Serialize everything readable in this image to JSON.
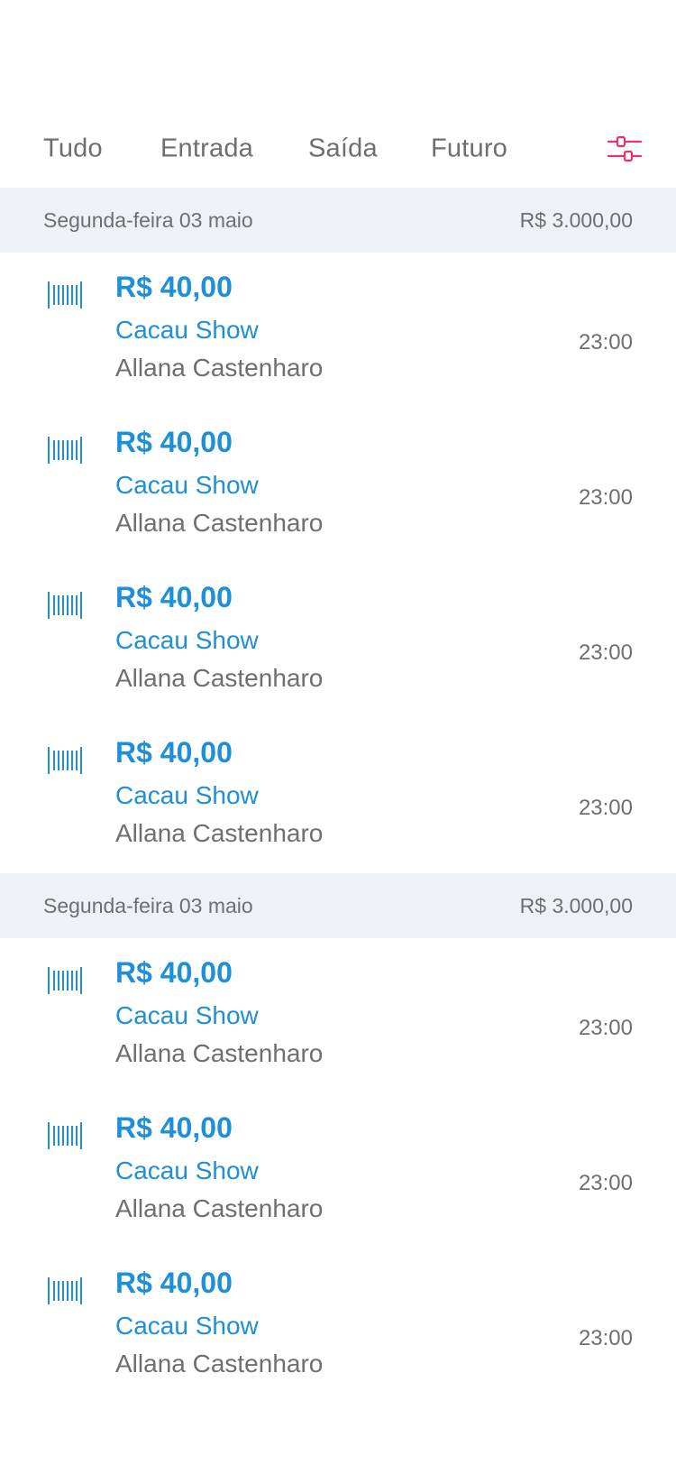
{
  "tabs": {
    "tudo": "Tudo",
    "entrada": "Entrada",
    "saida": "Saída",
    "futuro": "Futuro",
    "filter_icon": "sliders-icon"
  },
  "colors": {
    "accent": "#1e8fd8",
    "filter_icon": "#e8336b",
    "muted_text": "#6e6e73",
    "section_bg": "#eef2f7"
  },
  "sections": [
    {
      "date": "Segunda-feira 03 maio",
      "total": "R$ 3.000,00",
      "items": [
        {
          "icon": "barcode-icon",
          "amount": "R$ 40,00",
          "merchant": "Cacau Show",
          "person": "Allana Castenharo",
          "time": "23:00"
        },
        {
          "icon": "barcode-icon",
          "amount": "R$ 40,00",
          "merchant": "Cacau Show",
          "person": "Allana Castenharo",
          "time": "23:00"
        },
        {
          "icon": "barcode-icon",
          "amount": "R$ 40,00",
          "merchant": "Cacau Show",
          "person": "Allana Castenharo",
          "time": "23:00"
        },
        {
          "icon": "barcode-icon",
          "amount": "R$ 40,00",
          "merchant": "Cacau Show",
          "person": "Allana Castenharo",
          "time": "23:00"
        }
      ]
    },
    {
      "date": "Segunda-feira 03 maio",
      "total": "R$ 3.000,00",
      "items": [
        {
          "icon": "barcode-icon",
          "amount": "R$ 40,00",
          "merchant": "Cacau Show",
          "person": "Allana Castenharo",
          "time": "23:00"
        },
        {
          "icon": "barcode-icon",
          "amount": "R$ 40,00",
          "merchant": "Cacau Show",
          "person": "Allana Castenharo",
          "time": "23:00"
        },
        {
          "icon": "barcode-icon",
          "amount": "R$ 40,00",
          "merchant": "Cacau Show",
          "person": "Allana Castenharo",
          "time": "23:00"
        }
      ]
    }
  ]
}
